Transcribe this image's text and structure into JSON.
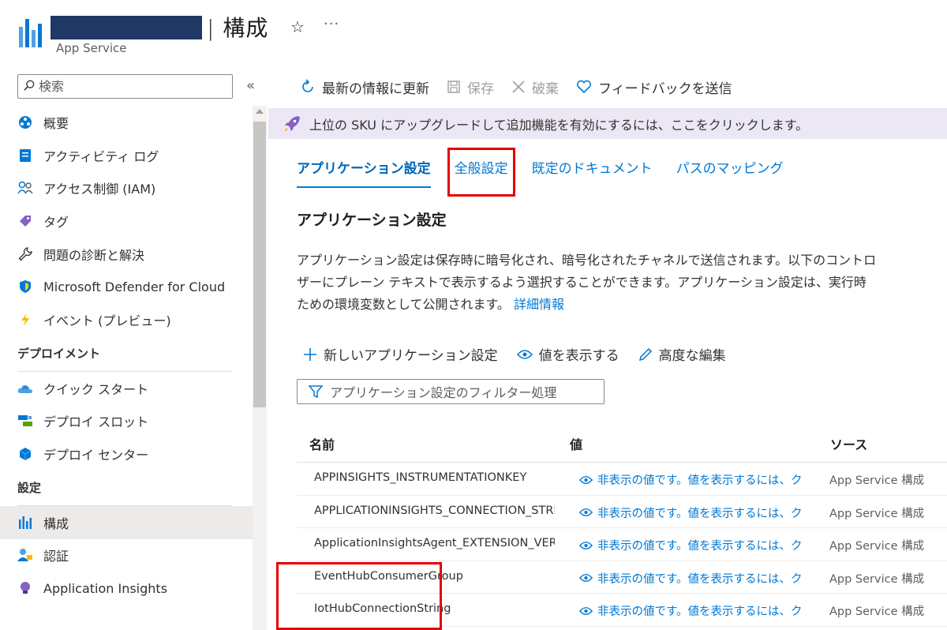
{
  "header": {
    "title": "| 構成",
    "subtitle": "App Service"
  },
  "sidebar": {
    "search_placeholder": "検索",
    "items": [
      {
        "label": "概要",
        "icon": "overview-icon"
      },
      {
        "label": "アクティビティ ログ",
        "icon": "activity-log-icon"
      },
      {
        "label": "アクセス制御 (IAM)",
        "icon": "access-control-icon"
      },
      {
        "label": "タグ",
        "icon": "tag-icon"
      },
      {
        "label": "問題の診断と解決",
        "icon": "wrench-icon"
      },
      {
        "label": "Microsoft Defender for Cloud",
        "icon": "shield-icon"
      },
      {
        "label": "イベント (プレビュー)",
        "icon": "lightning-icon"
      }
    ],
    "section_deploy": "デプロイメント",
    "deploy_items": [
      {
        "label": "クイック スタート",
        "icon": "cloud-icon"
      },
      {
        "label": "デプロイ スロット",
        "icon": "slots-icon"
      },
      {
        "label": "デプロイ センター",
        "icon": "cube-icon"
      }
    ],
    "section_settings": "設定",
    "settings_items": [
      {
        "label": "構成",
        "icon": "config-icon",
        "active": true
      },
      {
        "label": "認証",
        "icon": "auth-icon"
      },
      {
        "label": "Application Insights",
        "icon": "lightbulb-icon"
      }
    ]
  },
  "toolbar": {
    "refresh": "最新の情報に更新",
    "save": "保存",
    "discard": "破棄",
    "feedback": "フィードバックを送信"
  },
  "banner": {
    "text": "上位の SKU にアップグレードして追加機能を有効にするには、ここをクリックします。"
  },
  "tabs": [
    {
      "label": "アプリケーション設定",
      "active": true
    },
    {
      "label": "全般設定",
      "highlighted": true
    },
    {
      "label": "既定のドキュメント"
    },
    {
      "label": "パスのマッピング"
    }
  ],
  "section": {
    "title": "アプリケーション設定",
    "desc_line1": "アプリケーション設定は保存時に暗号化され、暗号化されたチャネルで送信されます。以下のコントロ",
    "desc_line2": "ザーにプレーン テキストで表示するよう選択することができます。アプリケーション設定は、実行時",
    "desc_line3": "ための環境変数として公開されます。",
    "learn_more": "詳細情報"
  },
  "commands": {
    "new_setting": "新しいアプリケーション設定",
    "show_values": "値を表示する",
    "advanced_edit": "高度な編集"
  },
  "filter": {
    "label": "アプリケーション設定のフィルター処理"
  },
  "table": {
    "headers": {
      "name": "名前",
      "value": "値",
      "source": "ソース"
    },
    "rows": [
      {
        "name": "APPINSIGHTS_INSTRUMENTATIONKEY",
        "value": "非表示の値です。値を表示するには、ク",
        "source": "App Service 構成"
      },
      {
        "name": "APPLICATIONINSIGHTS_CONNECTION_STRIN",
        "value": "非表示の値です。値を表示するには、ク",
        "source": "App Service 構成"
      },
      {
        "name": "ApplicationInsightsAgent_EXTENSION_VERSI",
        "value": "非表示の値です。値を表示するには、ク",
        "source": "App Service 構成"
      },
      {
        "name": "EventHubConsumerGroup",
        "value": "非表示の値です。値を表示するには、ク",
        "source": "App Service 構成"
      },
      {
        "name": "IotHubConnectionString",
        "value": "非表示の値です。値を表示するには、ク",
        "source": "App Service 構成"
      }
    ]
  },
  "colors": {
    "accent": "#0078d4",
    "highlight_box": "#e60000",
    "banner_bg": "#ece7f4",
    "redacted": "#1f3864"
  }
}
